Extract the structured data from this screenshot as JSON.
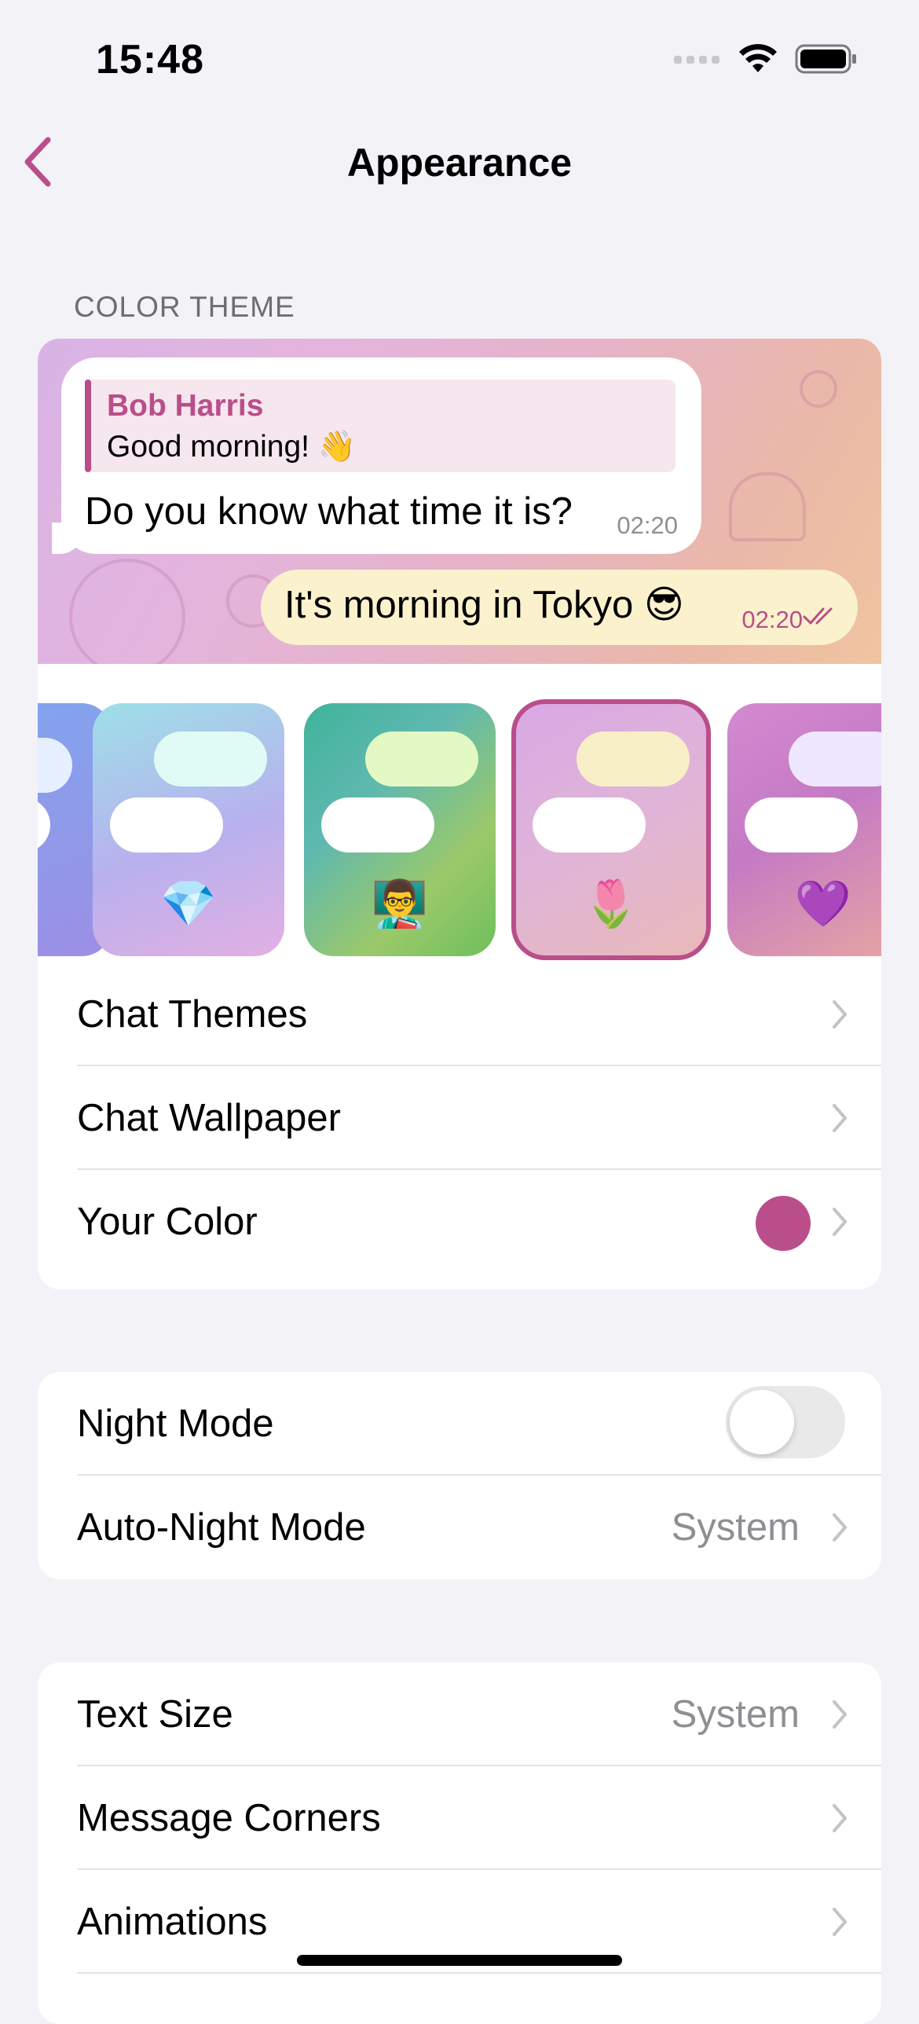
{
  "status": {
    "time": "15:48"
  },
  "nav": {
    "title": "Appearance"
  },
  "color_theme": {
    "header": "COLOR THEME",
    "preview": {
      "reply_name": "Bob Harris",
      "reply_text": "Good morning! 👋",
      "incoming_text": "Do you know what time it is?",
      "incoming_time": "02:20",
      "outgoing_text": "It's morning in Tokyo 😎",
      "outgoing_time": "02:20"
    },
    "themes": [
      {
        "emoji": "",
        "selected": false
      },
      {
        "emoji": "💎",
        "selected": false
      },
      {
        "emoji": "👨‍🏫",
        "selected": false
      },
      {
        "emoji": "🌷",
        "selected": true
      },
      {
        "emoji": "💜",
        "selected": false
      }
    ],
    "rows": {
      "chat_themes": "Chat Themes",
      "chat_wallpaper": "Chat Wallpaper",
      "your_color": "Your Color"
    },
    "your_color_value": "#b94e8a"
  },
  "night": {
    "night_mode": "Night Mode",
    "night_mode_on": false,
    "auto_night_mode": "Auto-Night Mode",
    "auto_night_value": "System"
  },
  "text": {
    "text_size": "Text Size",
    "text_size_value": "System",
    "message_corners": "Message Corners",
    "animations": "Animations"
  },
  "colors": {
    "accent": "#b94e8a",
    "background": "#f2f2f7"
  }
}
